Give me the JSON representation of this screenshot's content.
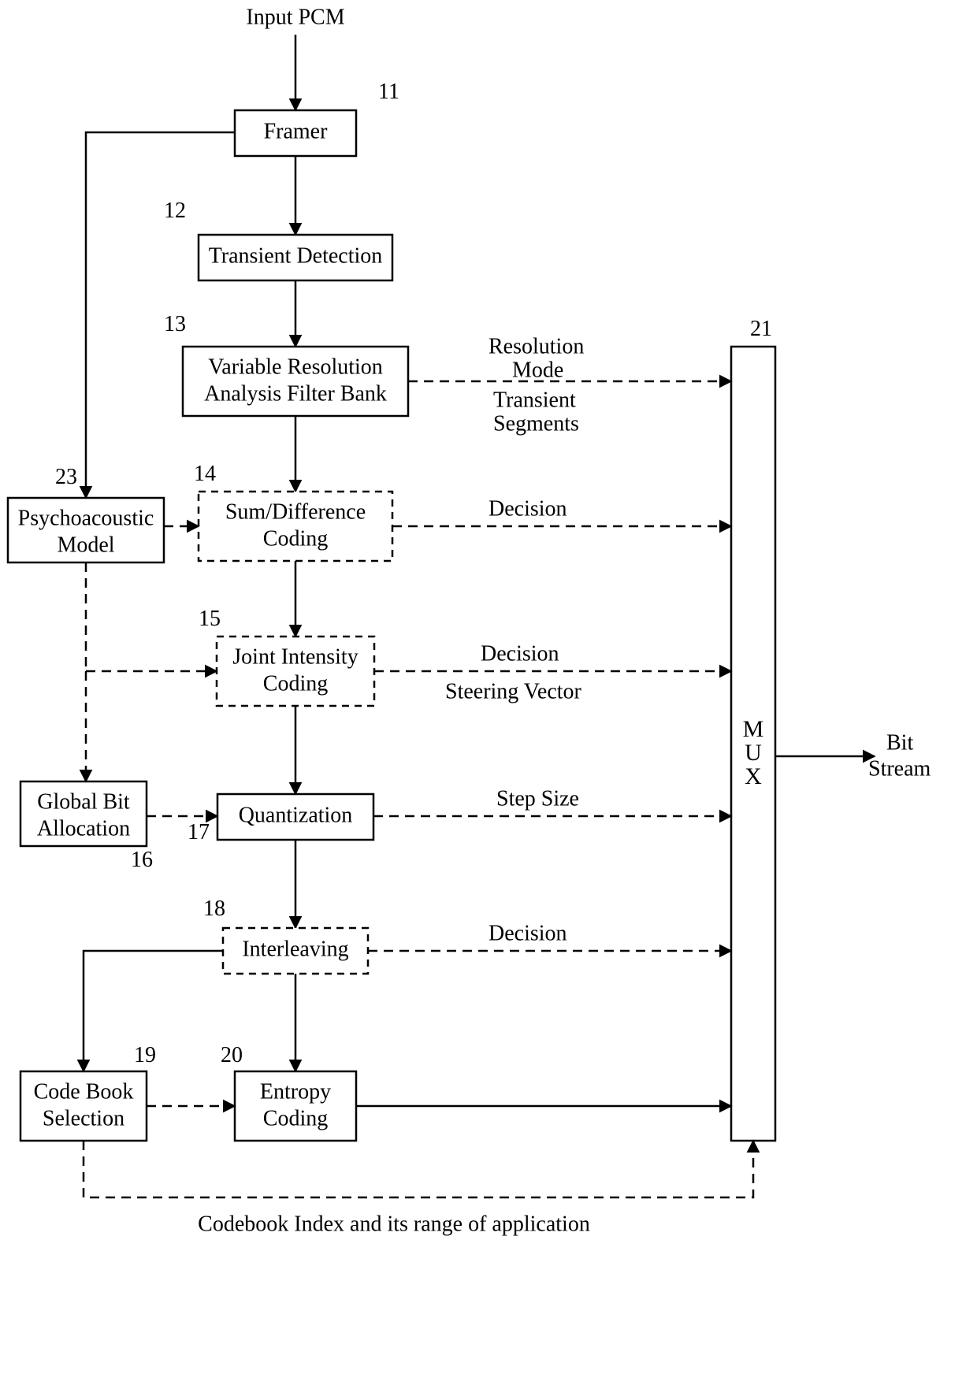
{
  "title": "Input PCM",
  "blocks": {
    "framer": {
      "label": "Framer",
      "num": "11"
    },
    "transient": {
      "label": "Transient Detection",
      "num": "12"
    },
    "filterbank": {
      "l1": "Variable Resolution",
      "l2": "Analysis Filter Bank",
      "num": "13"
    },
    "sumdiff": {
      "l1": "Sum/Difference",
      "l2": "Coding",
      "num": "14"
    },
    "joint": {
      "l1": "Joint Intensity",
      "l2": "Coding",
      "num": "15"
    },
    "quant": {
      "label": "Quantization",
      "num": "17"
    },
    "interleave": {
      "label": "Interleaving",
      "num": "18"
    },
    "entropy": {
      "l1": "Entropy",
      "l2": "Coding",
      "num": "20"
    },
    "psycho": {
      "l1": "Psychoacoustic",
      "l2": "Model",
      "num": "23"
    },
    "global": {
      "l1": "Global Bit",
      "l2": "Allocation",
      "num": "16"
    },
    "codebook": {
      "l1": "Code Book",
      "l2": "Selection",
      "num": "19"
    },
    "mux": {
      "label": "MUX",
      "num": "21"
    }
  },
  "edges": {
    "resmode": "Resolution",
    "mode2": "Mode",
    "transeg": "Transient",
    "seg2": "Segments",
    "decision": "Decision",
    "steering": "Steering Vector",
    "step": "Step Size",
    "codebook_caption": "Codebook Index and its range of application"
  },
  "output": {
    "l1": "Bit",
    "l2": "Stream"
  }
}
